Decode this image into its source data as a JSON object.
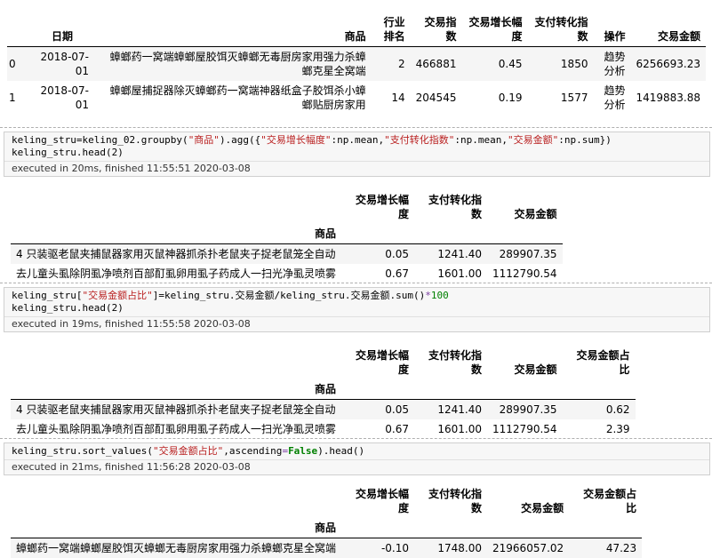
{
  "table1": {
    "headers": [
      "",
      "日期",
      "商品",
      "行业排名",
      "交易指数",
      "交易增长幅度",
      "支付转化指数",
      "操作",
      "交易金额"
    ],
    "rows": [
      [
        "0",
        "2018-07-01",
        "蟑螂药一窝端蟑螂屋胶饵灭蟑螂无毒厨房家用强力杀蟑螂克星全窝端",
        "2",
        "466881",
        "0.45",
        "1850",
        "趋势分析",
        "6256693.23"
      ],
      [
        "1",
        "2018-07-01",
        "蟑螂屋捕捉器除灭蟑螂药一窝端神器纸盒子胶饵杀小蟑螂贴厨房家用",
        "14",
        "204545",
        "0.19",
        "1577",
        "趋势分析",
        "1419883.88"
      ]
    ]
  },
  "cells": [
    {
      "code_line1_pre": "keling_stru=keling_02.groupby(",
      "code_line1_s1": "\"商品\"",
      "code_line1_mid1": ").agg({",
      "code_line1_s2": "\"交易增长幅度\"",
      "code_line1_mid2": ":np.mean,",
      "code_line1_s3": "\"支付转化指数\"",
      "code_line1_mid3": ":np.mean,",
      "code_line1_s4": "\"交易金额\"",
      "code_line1_post": ":np.sum})",
      "code_line2": "keling_stru.head(2)",
      "exec": "executed in 20ms, finished 11:55:51 2020-03-08"
    },
    {
      "code_line1_pre": "keling_stru[",
      "code_line1_s1": "\"交易金额占比\"",
      "code_line1_mid1": "]=keling_stru.交易金额/keling_stru.交易金额.sum()",
      "code_line1_op": "*",
      "code_line1_num": "100",
      "code_line2": "keling_stru.head(2)",
      "exec": "executed in 19ms, finished 11:55:58 2020-03-08"
    },
    {
      "code_line1_pre": "keling_stru.sort_values(",
      "code_line1_s1": "\"交易金额占比\"",
      "code_line1_mid1": ",ascending",
      "code_line1_op": "=",
      "code_line1_kw": "False",
      "code_line1_post": ").head()",
      "exec": "executed in 21ms, finished 11:56:28 2020-03-08"
    }
  ],
  "table2": {
    "headers": [
      "交易增长幅度",
      "支付转化指数",
      "交易金额"
    ],
    "index_name": "商品",
    "rows": [
      [
        "4 只装驱老鼠夹捕鼠器家用灭鼠神器抓杀扑老鼠夹子捉老鼠笼全自动",
        "0.05",
        "1241.40",
        "289907.35"
      ],
      [
        "去儿童头虱除阴虱净喷剂百部酊虱卵用虱子药成人一扫光净虱灵喷雾",
        "0.67",
        "1601.00",
        "1112790.54"
      ]
    ]
  },
  "table3": {
    "headers": [
      "交易增长幅度",
      "支付转化指数",
      "交易金额",
      "交易金额占比"
    ],
    "index_name": "商品",
    "rows": [
      [
        "4 只装驱老鼠夹捕鼠器家用灭鼠神器抓杀扑老鼠夹子捉老鼠笼全自动",
        "0.05",
        "1241.40",
        "289907.35",
        "0.62"
      ],
      [
        "去儿童头虱除阴虱净喷剂百部酊虱卵用虱子药成人一扫光净虱灵喷雾",
        "0.67",
        "1601.00",
        "1112790.54",
        "2.39"
      ]
    ]
  },
  "table4": {
    "headers": [
      "交易增长幅度",
      "支付转化指数",
      "交易金额",
      "交易金额占比"
    ],
    "index_name": "商品",
    "rows": [
      [
        "蟑螂药一窝端蟑螂屋胶饵灭蟑螂无毒厨房家用强力杀蟑螂克星全窝端",
        "-0.10",
        "1748.00",
        "21966057.02",
        "47.23"
      ]
    ]
  }
}
